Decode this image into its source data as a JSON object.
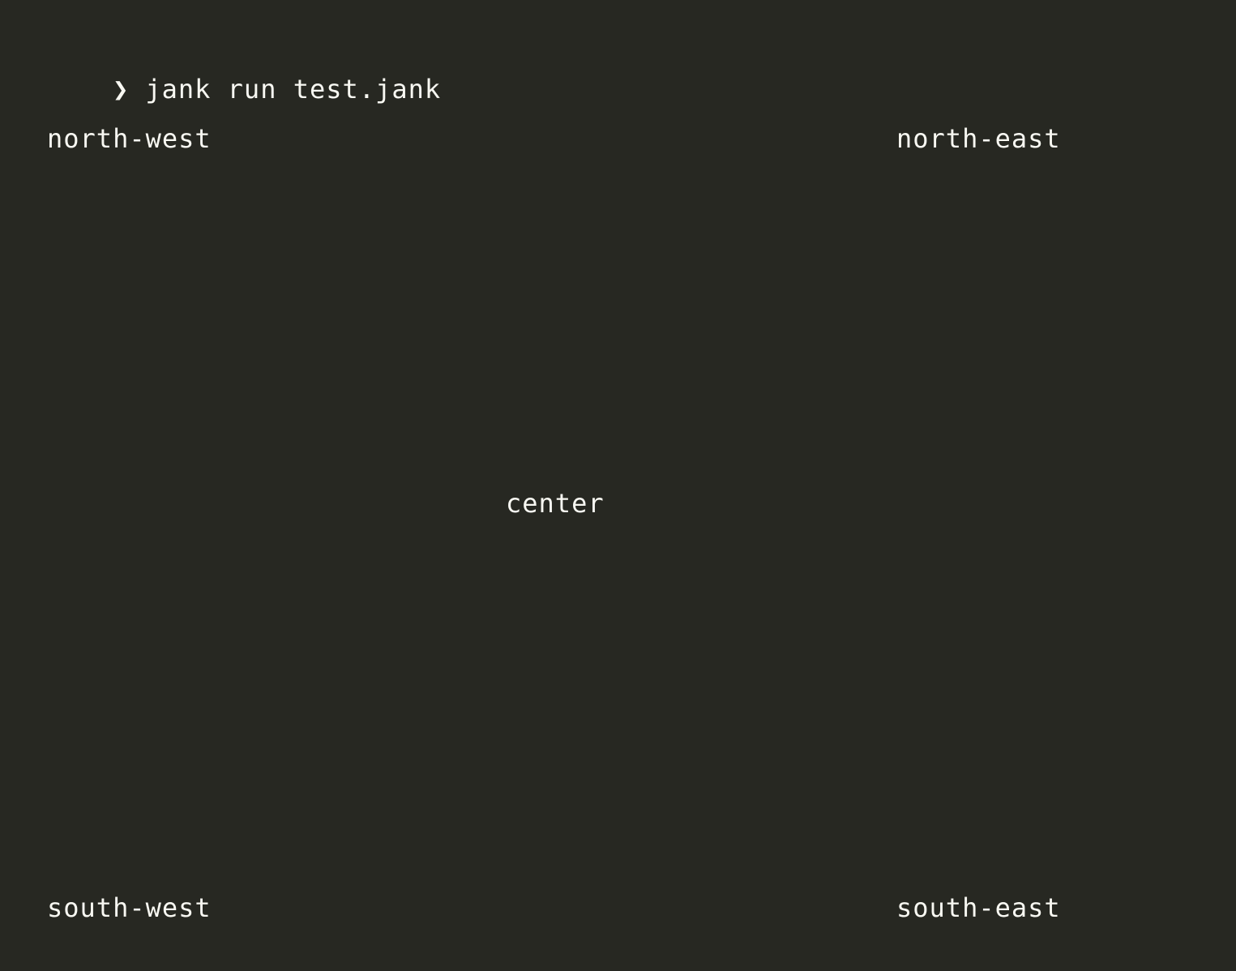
{
  "terminal": {
    "prompt_symbol": "❯",
    "command": "jank run test.jank",
    "output": {
      "north_west": "north-west",
      "north_east": "north-east",
      "center": "center",
      "south_west": "south-west",
      "south_east": "south-east"
    }
  },
  "colors": {
    "background": "#272822",
    "foreground": "#f8f8f2"
  }
}
